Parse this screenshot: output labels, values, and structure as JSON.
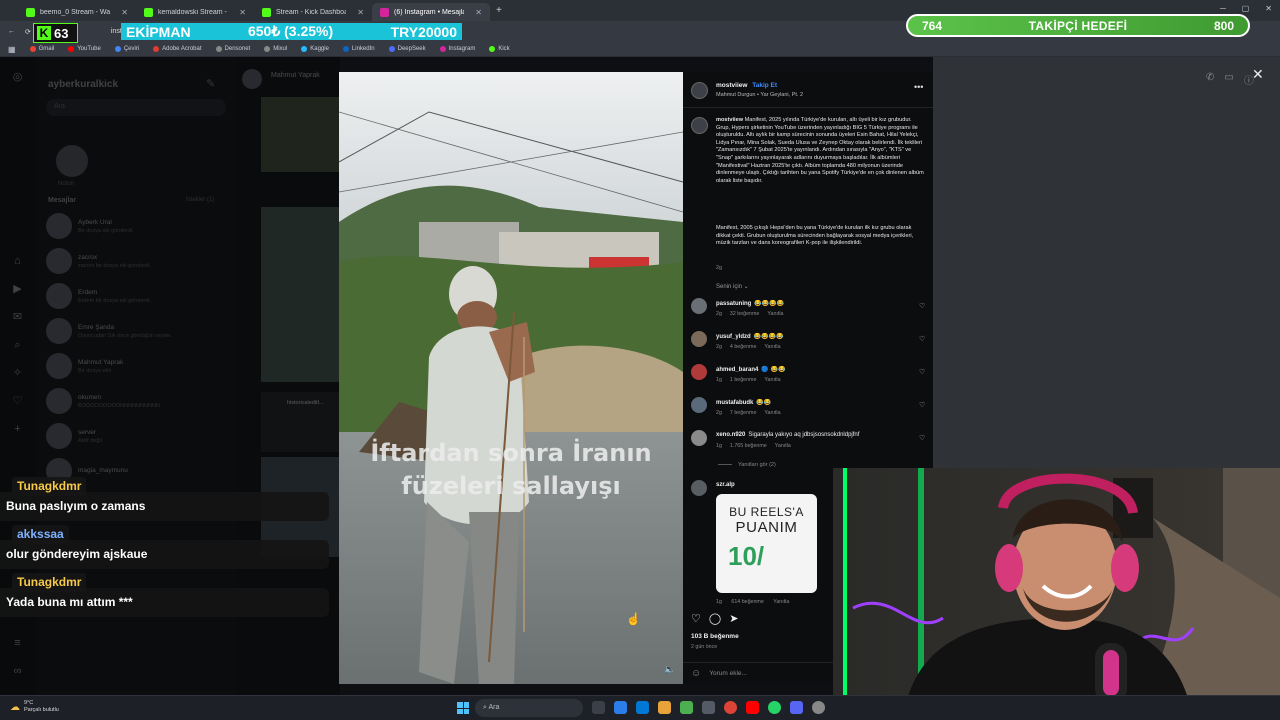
{
  "browser": {
    "tabs": [
      {
        "label": "beemo_0 Stream - Watch Live",
        "color": "#53fc18",
        "active": false
      },
      {
        "label": "kemaldowski Stream - Watch L",
        "color": "#53fc18",
        "active": false
      },
      {
        "label": "Stream - Kick Dashboard",
        "color": "#53fc18",
        "active": false
      },
      {
        "label": "(6) Instagram • Mesajlar",
        "color": "#d6249f",
        "active": true
      }
    ],
    "url": "instagram.com",
    "bookmarks": [
      {
        "label": "Gmail",
        "color": "#ea4335"
      },
      {
        "label": "YouTube",
        "color": "#ff0000"
      },
      {
        "label": "Çeviri",
        "color": "#4285f4"
      },
      {
        "label": "Adobe Acrobat",
        "color": "#e03c31"
      },
      {
        "label": "Densonet",
        "color": "#888888"
      },
      {
        "label": "Mixul",
        "color": "#888888"
      },
      {
        "label": "Kaggle",
        "color": "#20beff"
      },
      {
        "label": "LinkedIn",
        "color": "#0a66c2"
      },
      {
        "label": "DeepSeek",
        "color": "#4d6bfe"
      },
      {
        "label": "Instagram",
        "color": "#d6249f"
      },
      {
        "label": "Kick",
        "color": "#53fc18"
      }
    ]
  },
  "overlay": {
    "kick_viewers": "63",
    "sponsor_name": "EKİPMAN",
    "sponsor_amount": "650₺ (3.25%)",
    "sponsor_goal": "TRY20000",
    "follower_current": "764",
    "follower_label": "TAKİPÇİ HEDEFİ",
    "follower_target": "800"
  },
  "instagram": {
    "username": "ayberkuralkick",
    "search_placeholder": "Ara",
    "note_label": "Notun",
    "messages_header": "Mesajlar",
    "requests_label": "İstekler (1)",
    "conversations": [
      {
        "name": "Ayberk Ural",
        "preview": "Bir dosya eki gönderdi."
      },
      {
        "name": "zacrox",
        "preview": "zacrox bir dosya eki gönderdi."
      },
      {
        "name": "Erdem",
        "preview": "Erdem bir dosya eki gönderdi."
      },
      {
        "name": "Emre Şanda",
        "preview": "Oyuncudan Sık önce gördüğün reyste."
      },
      {
        "name": "Mahmut Yaprak",
        "preview": "Bir dosya ekti"
      },
      {
        "name": "okumen",
        "preview": "BOOOOOOOOONNNNNNNNNN"
      },
      {
        "name": "server",
        "preview": "Aktif değil"
      },
      {
        "name": "magia_maymunu",
        "preview": ""
      }
    ],
    "feed_sender": "Mahmut Yaprak",
    "feed_shared_user": "historicaleditI..."
  },
  "reel": {
    "caption_overlay_line1": "İftardan sonra İranın",
    "caption_overlay_line2": "füzeleri sallayışı",
    "author": "mostviiew",
    "follow_label": "Takip Et",
    "audio": "Mahmut Durgun • Yar Geylani, Pt. 2",
    "description_author": "mostviiew",
    "description": "Manifest, 2025 yılında Türkiye'de kurulan, altı üyeli bir kız grubudur. Grup, Hypers şirketinin YouTube üzerinden yayınladığı BIG 5 Türkiye programı ile oluşturuldu. Altı aylık bir kamp sürecinin sonunda üyeleri Esin Bahat, Hilal Yelekçi, Lidya Pınar, Mina Solak, Sueda Ulusa ve Zeynep Oktay olarak belirlendi. İlk teklileri \"Zamansızdık\" 7 Şubat 2025'te yayınlandı. Ardından sırasıyla \"Anyo\", \"KTS\" ve \"Snap\" şarkılarını yayınlayarak adlarını duyurmaya başladılar. İlk albümleri \"Manifestival\" Haziran 2025'te çıktı. Albüm toplamda 480 milyonun üzerinde dinlenmeye ulaştı. Çıktığı tarihten bu yana Spotify Türkiye'de en çok dinlenen albüm olarak liste başıdır.",
    "description_2": "Manifest, 2005 çıkışlı Hepsi'den bu yana Türkiye'de kurulan ilk kız grubu olarak dikkat çekti. Grubun oluşturulma sürecinden bağlayarak sosyal medya içerikleri, müzik tarzları ve dans koreografileri K-pop ile ilişkilendirildi.",
    "description_age": "2g",
    "for_you_label": "Senin için ⌄",
    "comments": [
      {
        "user": "passatuning",
        "text": "😂😂😂😂",
        "age": "2g",
        "likes": "32 beğenme",
        "reply": "Yanıtla"
      },
      {
        "user": "yusuf_yldzd",
        "text": "😂😂😂😂",
        "age": "2g",
        "likes": "4 beğenme",
        "reply": "Yanıtla"
      },
      {
        "user": "ahmed_baran4",
        "text": "🔵 😂😂",
        "age": "1g",
        "likes": "1 beğenme",
        "reply": "Yanıtla"
      },
      {
        "user": "mustafabudk",
        "text": "😂😂",
        "age": "2g",
        "likes": "7 beğenme",
        "reply": "Yanıtla"
      },
      {
        "user": "xeno.n920",
        "text": "Sigarayla yakıyo aq jdbsjsosnsokdnldpjfnf",
        "age": "1g",
        "likes": "1.765 beğenme",
        "reply": "Yanıtla"
      }
    ],
    "view_replies": "Yanıtları gör (2)",
    "gif_comment": {
      "user": "szr.alp",
      "age": "1g",
      "likes": "614 beğenme",
      "reply": "Yanıtla"
    },
    "gif_line1": "BU REELS'A",
    "gif_line2": "PUANIM",
    "gif_line3": "10/",
    "total_likes": "103 B beğenme",
    "post_date": "2 gün önce",
    "add_comment_placeholder": "Yorum ekle..."
  },
  "chat": [
    {
      "user": "Tunagkdmr",
      "user_color": "#f7c948",
      "message": "Buna paslıyım o zamans"
    },
    {
      "user": "akkssaa",
      "user_color": "#7fb2ff",
      "message": "olur göndereyim ajskaue"
    },
    {
      "user": "Tunagkdmr",
      "user_color": "#f7c948",
      "message": "Yada buna mı attım ***"
    }
  ],
  "taskbar": {
    "temperature": "9°C",
    "weather": "Parçalı bulutlu",
    "search_placeholder": "Ara"
  }
}
